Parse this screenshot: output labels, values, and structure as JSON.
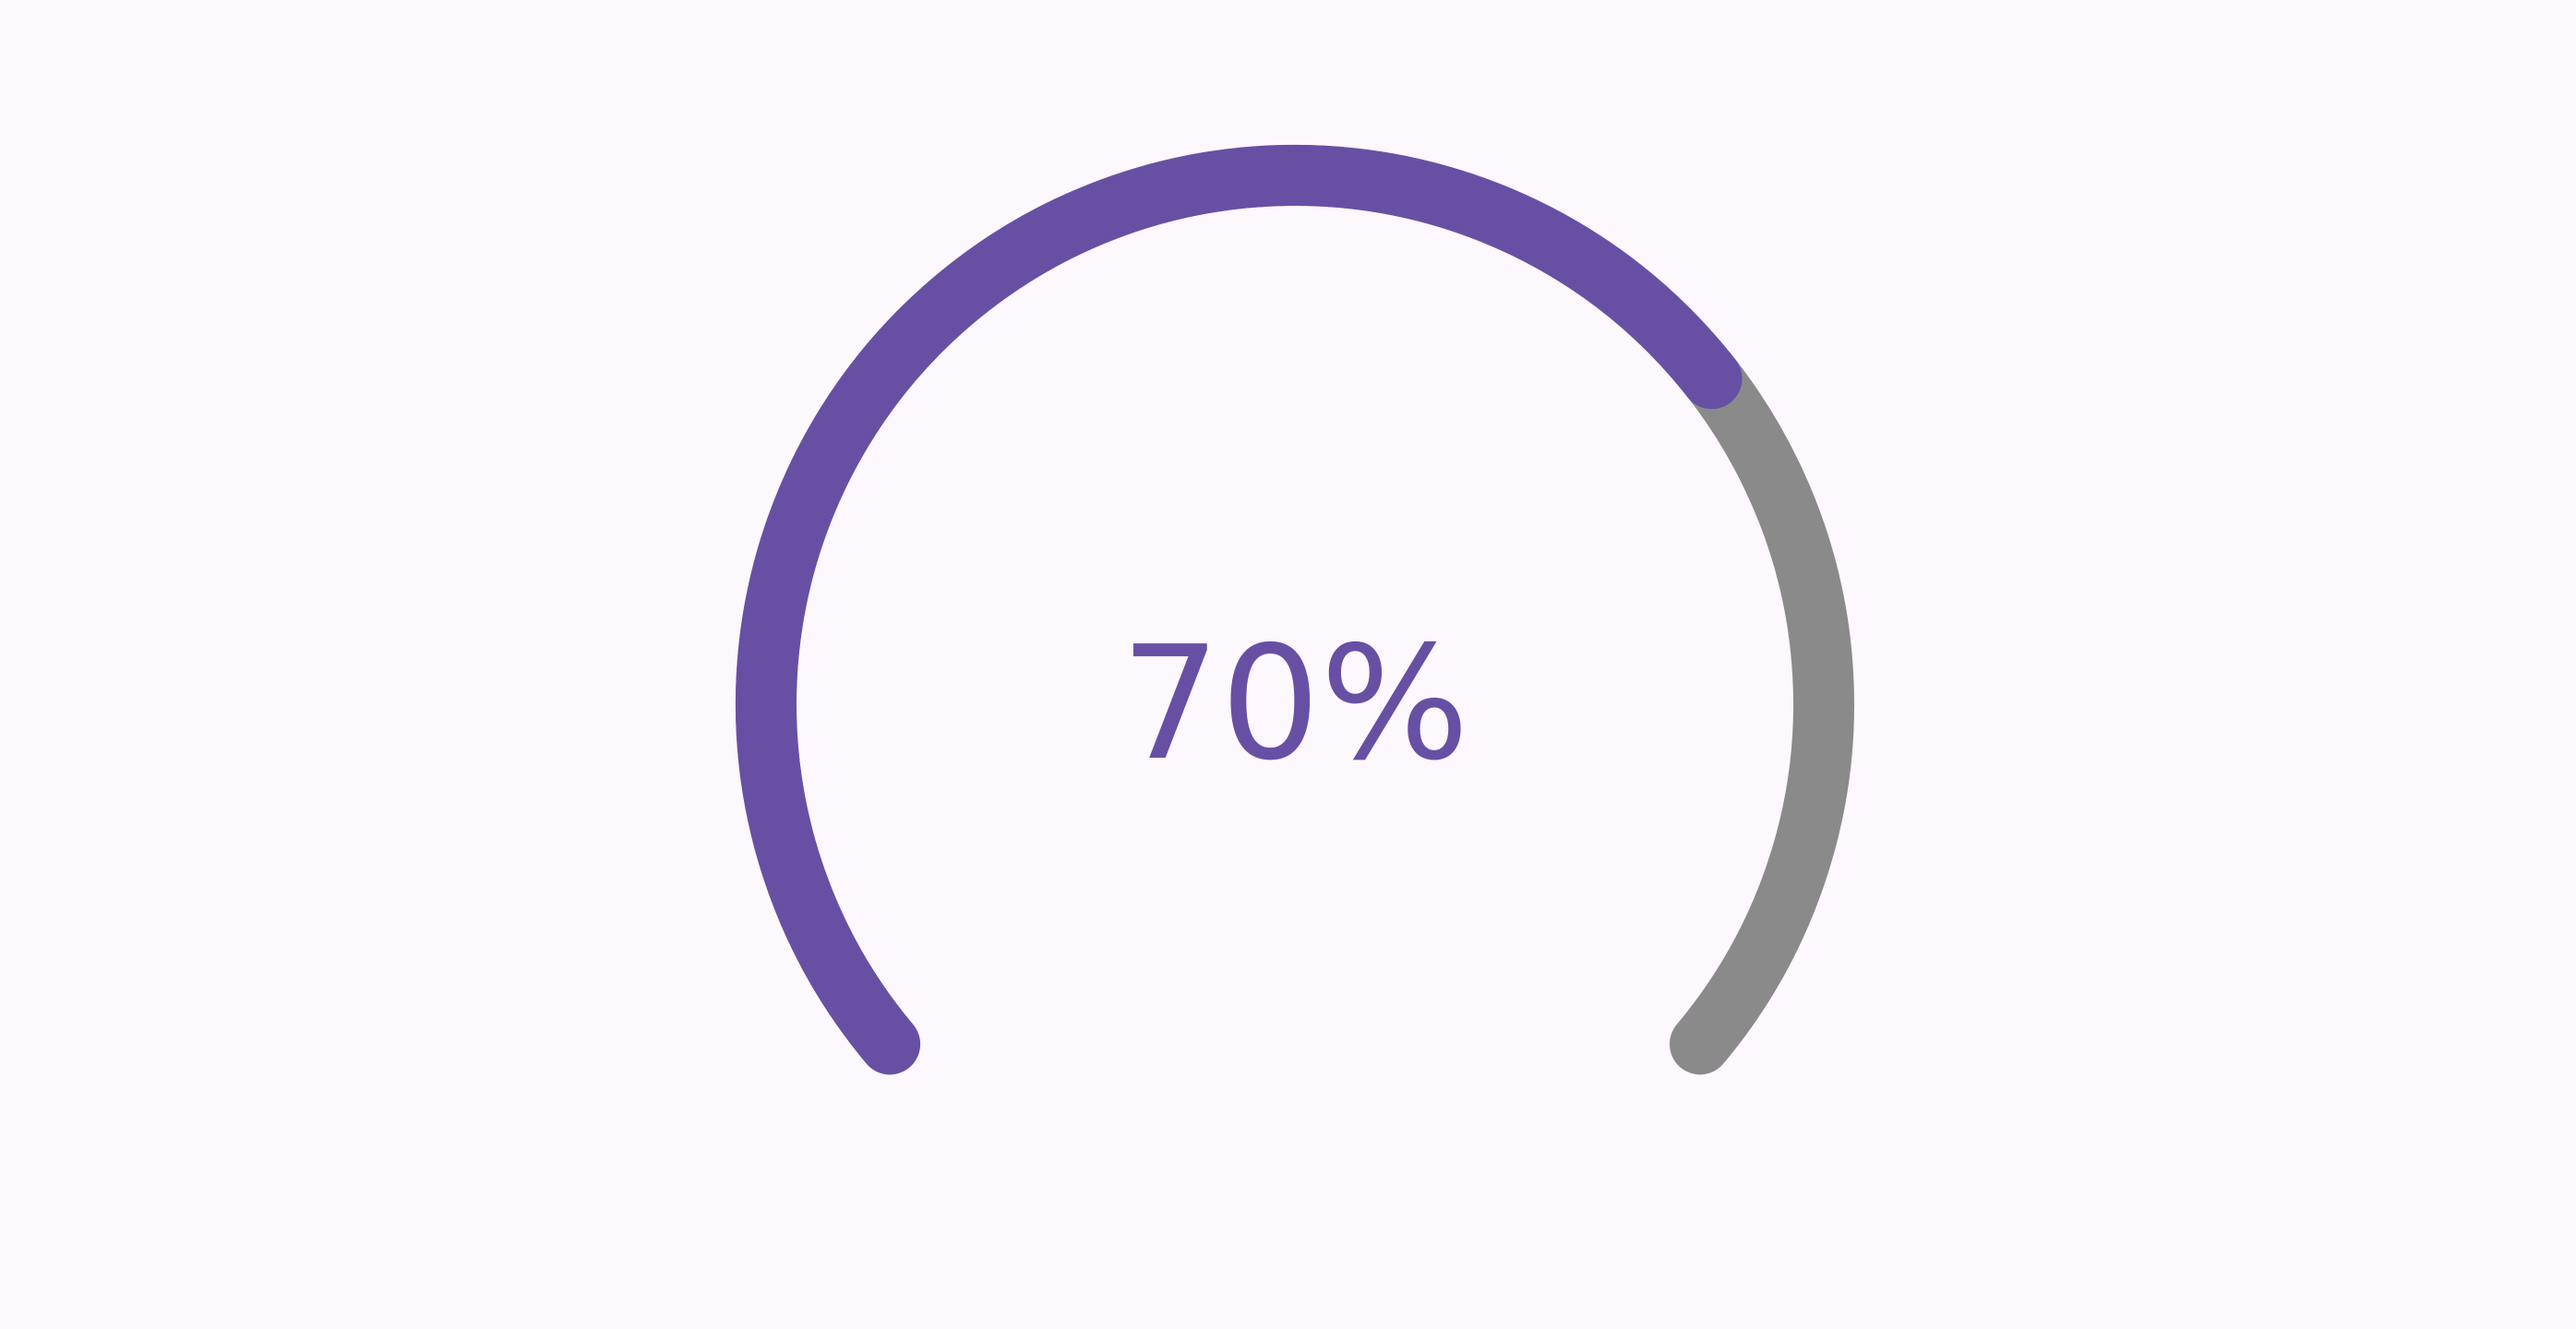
{
  "gauge": {
    "progress": 0.7,
    "label": "70%",
    "colors": {
      "background": "#fdf7fe",
      "progress": "#6750a4",
      "track": "#8a8a8a",
      "text": "#6750a4"
    }
  }
}
